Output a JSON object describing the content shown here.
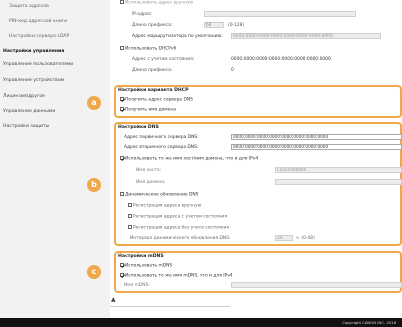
{
  "sidebar": {
    "items": [
      {
        "label": "Защита адресов",
        "kind": "sub"
      },
      {
        "label": "PIN-код адресной книги",
        "kind": "sub"
      },
      {
        "label": "Настройки сервера LDAP",
        "kind": "sub"
      },
      {
        "label": "Настройки управления",
        "kind": "active"
      },
      {
        "label": "Управление пользователями",
        "kind": "normal"
      },
      {
        "label": "Управление устройством",
        "kind": "normal"
      },
      {
        "label": "Лицензия/другое",
        "kind": "normal"
      },
      {
        "label": "Управление данными",
        "kind": "normal"
      },
      {
        "label": "Настройки защиты",
        "kind": "normal"
      }
    ]
  },
  "ipv6_top": {
    "use_manual_label": "Использовать адрес вручную",
    "ip_label": "IP-адрес:",
    "ip_value": "0000:0000:0000:0000:0000:0000",
    "prefix_label": "Длина префикса:",
    "prefix_value": "64",
    "prefix_range": "(0-128)",
    "router_label": "Адрес маршрутизатора по умолчанию:",
    "router_value": "0000:0000:0000:0000:0000:0000:0000:0000",
    "dhcpv6_label": "Использовать DHCPv6",
    "state_addr_label": "Адрес с учетом состояния:",
    "state_addr_value": "0000:0000:0000:0000:0000:0000:0000:0000",
    "prefix2_label": "Длина префикса:",
    "prefix2_value": "0"
  },
  "dhcp_option": {
    "title": "Настройки варианта DHCP",
    "get_dns": "Получить адрес сервера DNS",
    "get_domain": "Получить имя домена",
    "get_dns_checked": true,
    "get_domain_checked": true
  },
  "dns": {
    "title": "Настройки DNS",
    "primary_label": "Адрес первичного сервера DNS:",
    "primary_value": "0000:0000:0000:0000:0000:0000:0000:0000",
    "secondary_label": "Адрес вторичного сервера DNS:",
    "secondary_value": "0000:0000:0000:0000:0000:0000:0000:0000",
    "same_host_label": "Использовать то же имя хост/имя домена, что и для IPv4",
    "same_host_checked": true,
    "host_label": "Имя хоста:",
    "host_value": "Canon000000",
    "domain_label": "Имя домена:",
    "domain_value": "",
    "dynamic_label": "Динамическое обновление DNS",
    "dynamic_checked": false,
    "reg_manual": "Регистрация адреса вручную",
    "reg_stateful": "Регистрация адреса с учетом состояния",
    "reg_stateless": "Регистрация адреса без учета состояния",
    "interval_label": "Интервал динамического обновления DNS:",
    "interval_value": "24",
    "interval_unit": "ч. (0-48)"
  },
  "mdns": {
    "title": "Настройки mDNS",
    "use_label": "Использовать mDNS",
    "use_checked": true,
    "same_label": "Использовать то же имя mDNS, что и для IPv4",
    "same_checked": true,
    "name_label": "Имя mDNS:",
    "name_value": ""
  },
  "badges": {
    "a": "a",
    "b": "b",
    "c": "c"
  },
  "footer": {
    "copyright": "Copyright CANON INC. 2016"
  },
  "colors": {
    "accent": "#f0a84a",
    "footer": "#111111"
  }
}
